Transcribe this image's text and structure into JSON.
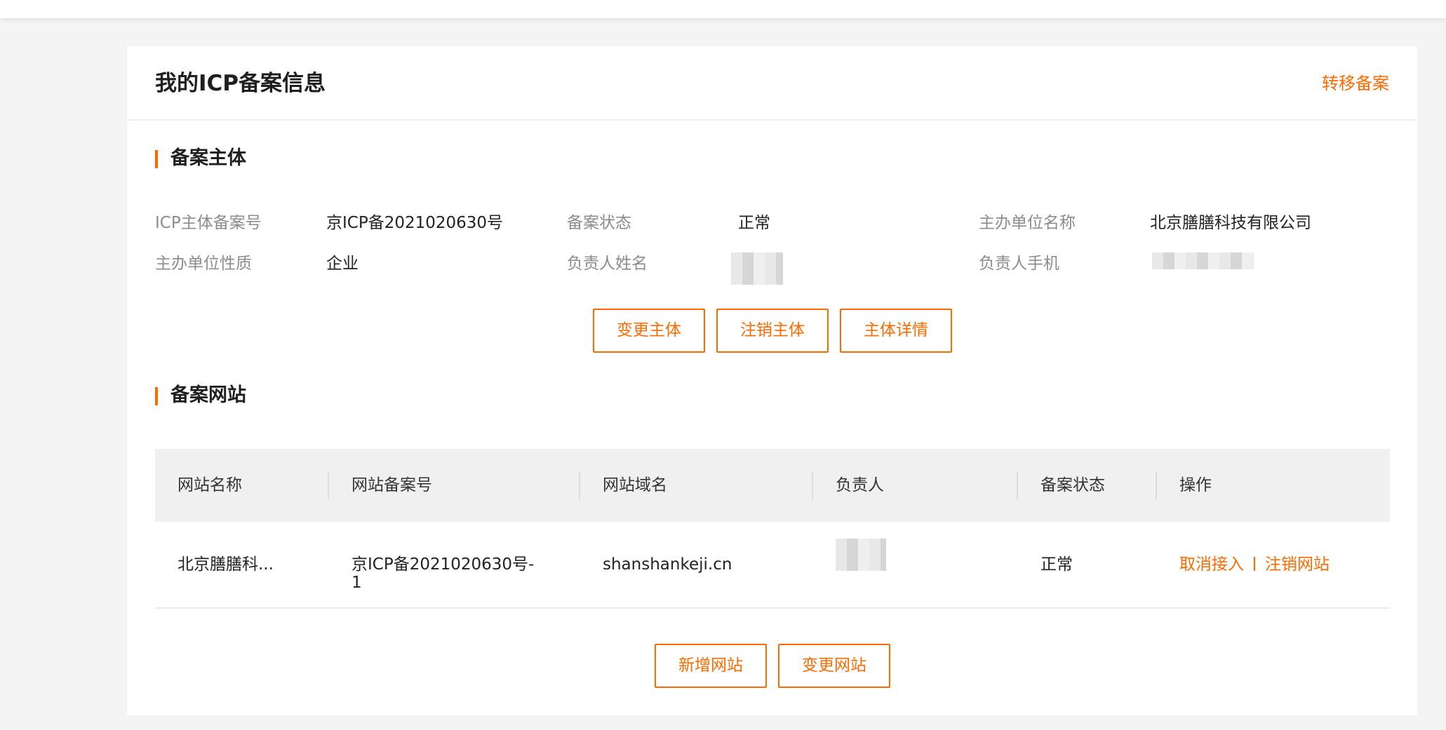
{
  "header": {
    "title": "我的ICP备案信息",
    "transfer_link": "转移备案"
  },
  "subject_section": {
    "title": "备案主体",
    "fields": [
      {
        "label": "ICP主体备案号",
        "value": "京ICP备2021020630号"
      },
      {
        "label": "备案状态",
        "value": "正常"
      },
      {
        "label": "主办单位名称",
        "value": "北京膳膳科技有限公司"
      },
      {
        "label": "主办单位性质",
        "value": "企业"
      },
      {
        "label": "负责人姓名",
        "value": ""
      },
      {
        "label": "负责人手机",
        "value": ""
      }
    ],
    "buttons": {
      "change": "变更主体",
      "cancel": "注销主体",
      "detail": "主体详情"
    }
  },
  "website_section": {
    "title": "备案网站",
    "columns": [
      "网站名称",
      "网站备案号",
      "网站域名",
      "负责人",
      "备案状态",
      "操作"
    ],
    "rows": [
      {
        "name": "北京膳膳科...",
        "record_no_line1": "京ICP备2021020630号-",
        "record_no_line2": "1",
        "domain": "shanshankeji.cn",
        "owner": "",
        "status": "正常",
        "action_cancel_access": "取消接入",
        "action_cancel_site": "注销网站"
      }
    ],
    "buttons": {
      "add": "新增网站",
      "change": "变更网站"
    }
  },
  "colors": {
    "accent": "#ff6a00",
    "background": "#f4f4f4",
    "table_header": "#f0f0f0"
  }
}
